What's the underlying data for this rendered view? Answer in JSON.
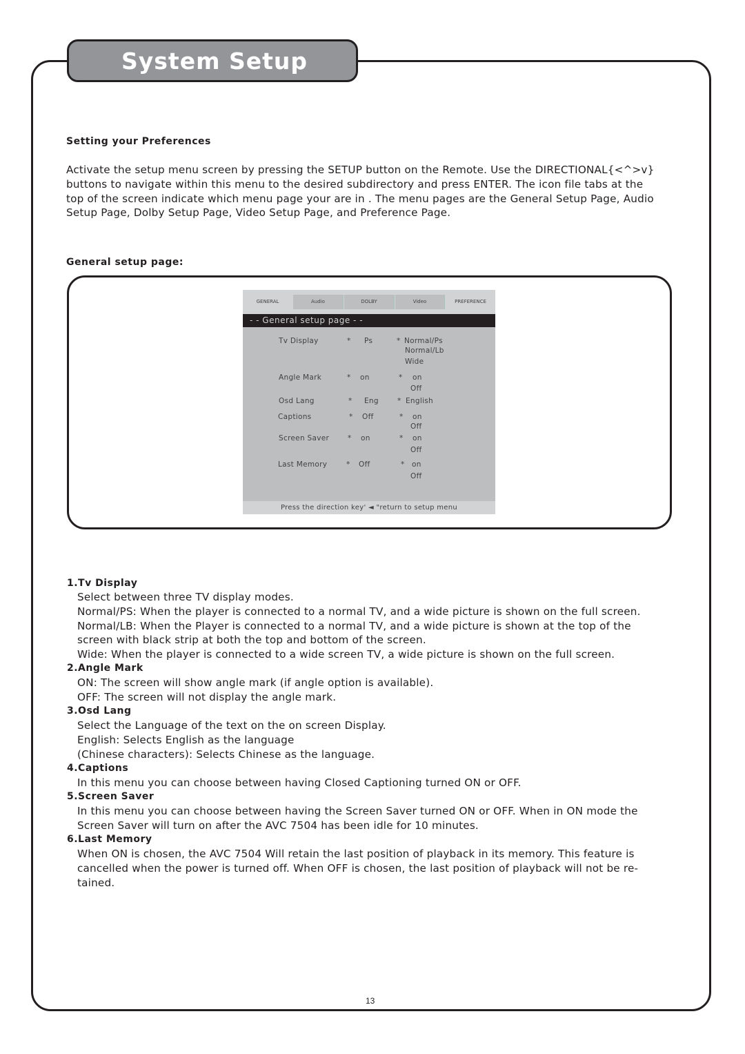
{
  "page": {
    "title": "System Setup",
    "page_number": "13"
  },
  "intro": {
    "heading": "Setting your Preferences",
    "lines": [
      "Activate the setup menu screen by pressing the SETUP button on the Remote. Use the DIRECTIONAL{<^>v}",
      "buttons to navigate within this menu to the desired subdirectory and press ENTER. The icon file tabs at the",
      "top of the screen indicate which menu page your are in . The menu pages are the General Setup Page, Audio",
      "Setup Page, Dolby Setup Page, Video Setup Page, and Preference Page."
    ]
  },
  "general_setup": {
    "heading": "General setup page:"
  },
  "osd": {
    "tabs": [
      {
        "label": "GENERAL",
        "active": true
      },
      {
        "label": "Audio",
        "active": false
      },
      {
        "label": "DOLBY",
        "active": false
      },
      {
        "label": "Video",
        "active": false
      },
      {
        "label": "PREFERENCE",
        "active": true
      }
    ],
    "header": "- -  General setup page  - -",
    "rows": [
      {
        "name": "Tv Display",
        "current": "Ps",
        "options": [
          "Normal/Ps",
          "Normal/Lb",
          "Wide"
        ]
      },
      {
        "name": "Angle Mark",
        "current": "on",
        "options": [
          "on",
          "Off"
        ]
      },
      {
        "name": "Osd Lang",
        "current": "Eng",
        "options": [
          "English"
        ]
      },
      {
        "name": "Captions",
        "current": "Off",
        "options": [
          "on",
          "Off"
        ]
      },
      {
        "name": "Screen Saver",
        "current": "on",
        "options": [
          "on",
          "Off"
        ]
      },
      {
        "name": "Last Memory",
        "current": "Off",
        "options": [
          "on",
          "Off"
        ]
      }
    ],
    "bullet": "*",
    "footer": "Press the direction key' ◄ \"return to setup menu",
    "colors": {
      "panel": "#bcbec0",
      "tab_bar": "#d1d3d4",
      "header_bg": "#231f20"
    }
  },
  "sections": [
    {
      "heading": "1.Tv Display",
      "lines": [
        "Select between three TV display modes.",
        "Normal/PS: When the player is connected to a normal TV, and a wide picture is shown on the full screen.",
        "Normal/LB: When the Player is connected to a normal TV, and a wide picture is shown at the top of the",
        "screen with black strip at both the top and bottom of the screen.",
        "Wide: When the player is connected to a wide screen TV, a wide picture is shown on the full screen."
      ]
    },
    {
      "heading": "2.Angle Mark",
      "lines": [
        "ON: The screen will show angle mark (if angle option is available).",
        "OFF: The screen will not display the angle mark."
      ]
    },
    {
      "heading": "3.Osd Lang",
      "lines": [
        "Select the Language of the text on the on screen Display.",
        "English: Selects English as the language",
        "(Chinese characters): Selects Chinese as the language."
      ]
    },
    {
      "heading": "4.Captions",
      "lines": [
        "In this menu you can choose between having Closed Captioning turned ON or OFF."
      ]
    },
    {
      "heading": "5.Screen Saver",
      "lines": [
        "In this menu you can choose between having the Screen Saver turned ON or OFF. When in ON mode the",
        "Screen Saver will turn on after the AVC 7504 has been idle for 10 minutes."
      ]
    },
    {
      "heading": "6.Last Memory",
      "lines": [
        "When ON is chosen, the AVC 7504 Will retain the last position of playback in its memory. This feature is",
        "cancelled when the power is turned off. When OFF is chosen, the last position of playback will not be re-",
        "tained."
      ]
    }
  ]
}
